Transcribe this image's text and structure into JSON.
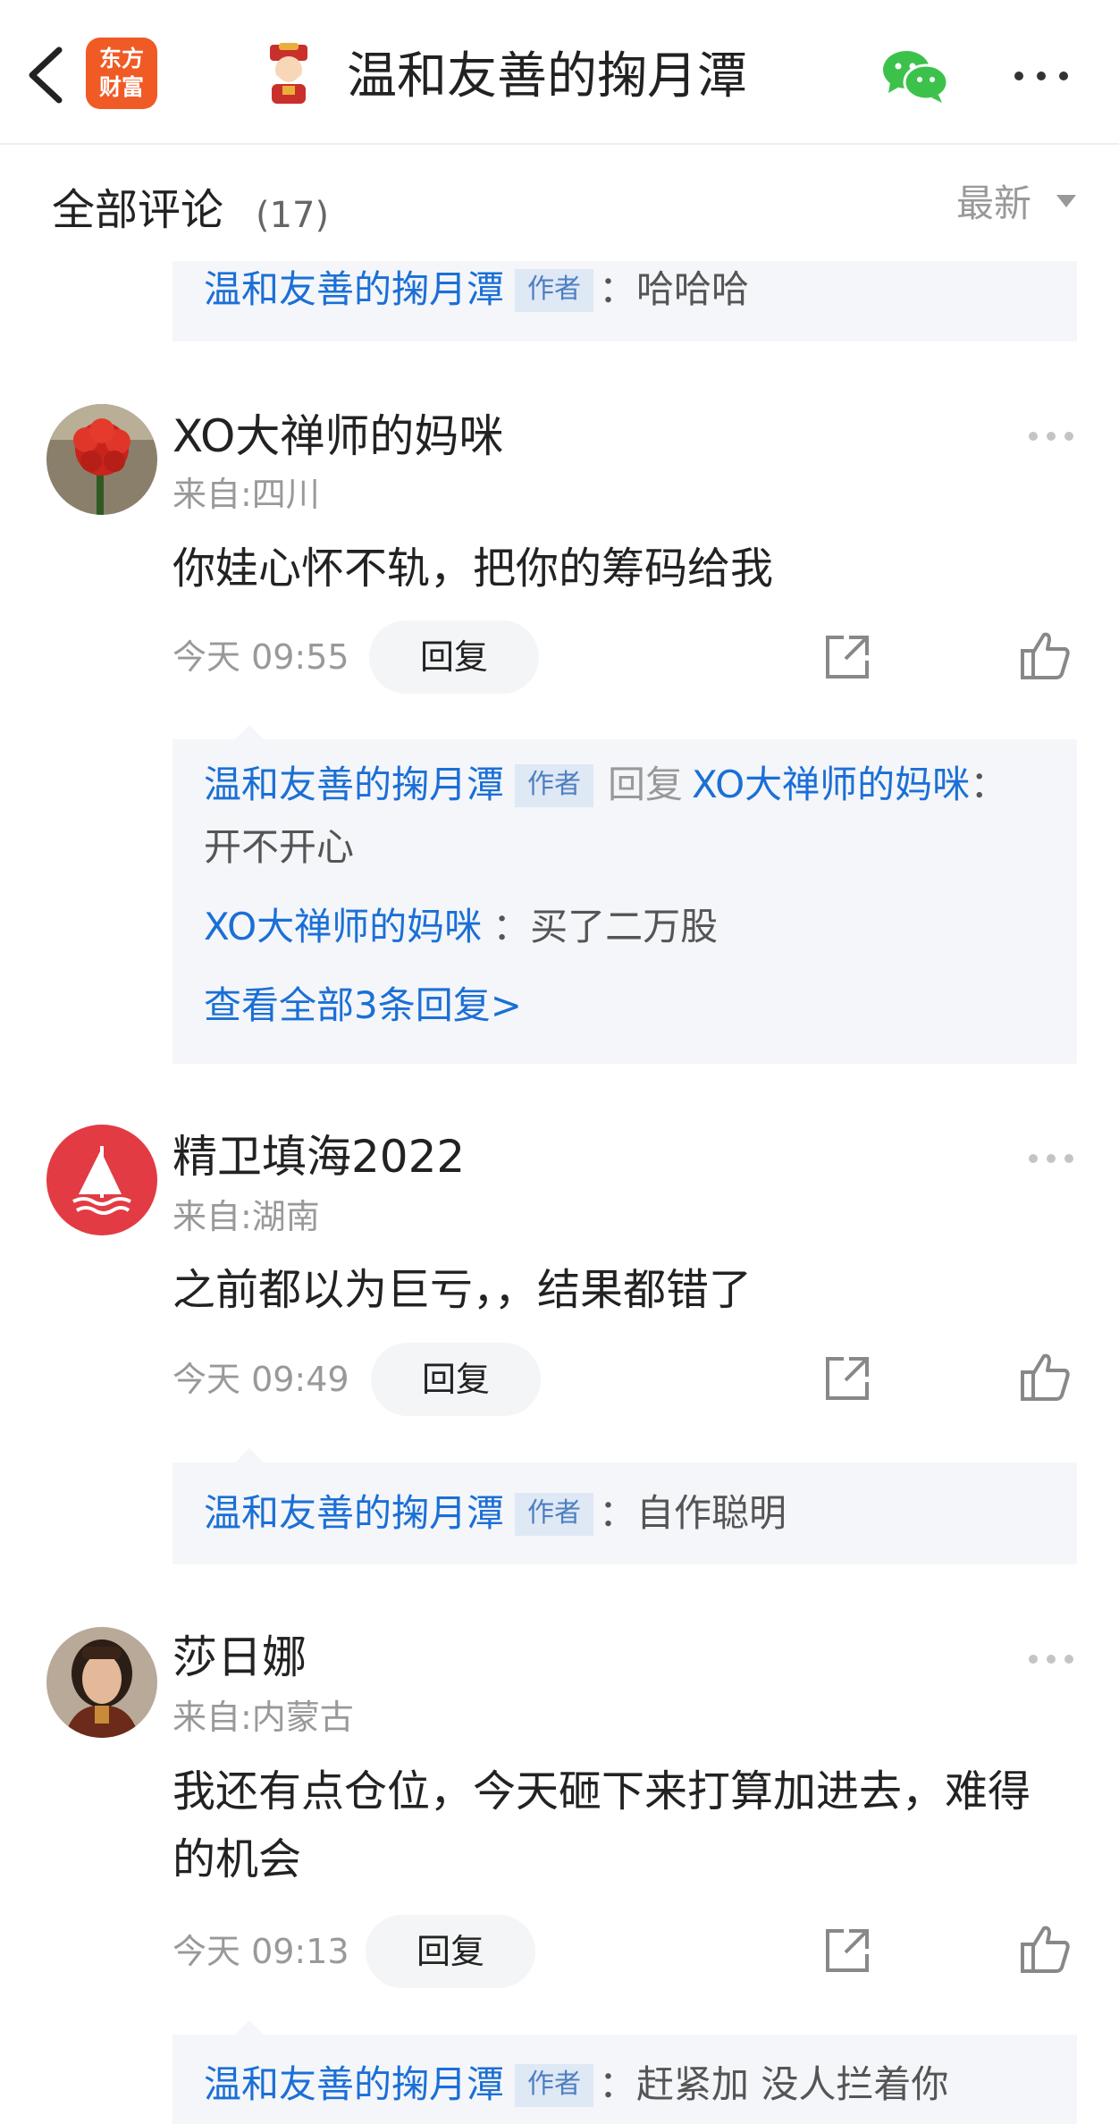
{
  "nav": {
    "logo_line1": "东方",
    "logo_line2": "财富",
    "title": "温和友善的掬月潭",
    "icons": [
      "chevron-left-icon",
      "wechat-icon",
      "more-icon"
    ]
  },
  "comments_header": {
    "title": "全部评论",
    "count": "(17)",
    "sort_label": "最新"
  },
  "top_partial_reply": {
    "name": "温和友善的掬月潭",
    "tag": "作者",
    "text": "：哈哈哈"
  },
  "comments": [
    {
      "username": "XO大禅师的妈咪",
      "location": "来自:四川",
      "text": "你娃心怀不轨，把你的筹码给我",
      "time": "今天 09:55",
      "reply_label": "回复",
      "replies": [
        {
          "name": "温和友善的掬月潭",
          "tag": "作者",
          "reply_word": "回复",
          "target": "XO大禅师的妈咪",
          "colon": "：",
          "text": "开不开心"
        },
        {
          "name": "XO大禅师的妈咪",
          "text": "：买了二万股"
        }
      ],
      "see_all": "查看全部3条回复>"
    },
    {
      "username": "精卫填海2022",
      "location": "来自:湖南",
      "text": "之前都以为巨亏，，结果都错了",
      "time": "今天 09:49",
      "reply_label": "回复",
      "replies": [
        {
          "name": "温和友善的掬月潭",
          "tag": "作者",
          "text": "：自作聪明"
        }
      ]
    },
    {
      "username": "莎日娜",
      "location": "来自:内蒙古",
      "text": "我还有点仓位，今天砸下来打算加进去，难得的机会",
      "time": "今天 09:13",
      "reply_label": "回复",
      "replies": [
        {
          "name": "温和友善的掬月潭",
          "tag": "作者",
          "text": "：赶紧加 没人拦着你"
        }
      ]
    }
  ],
  "colors": {
    "link_blue": "#1b6fd6",
    "brand_orange": "#f05a24",
    "reply_bg": "#f4f6f9",
    "avatar_red": "#e23b44",
    "wechat_green": "#3cc24b"
  }
}
